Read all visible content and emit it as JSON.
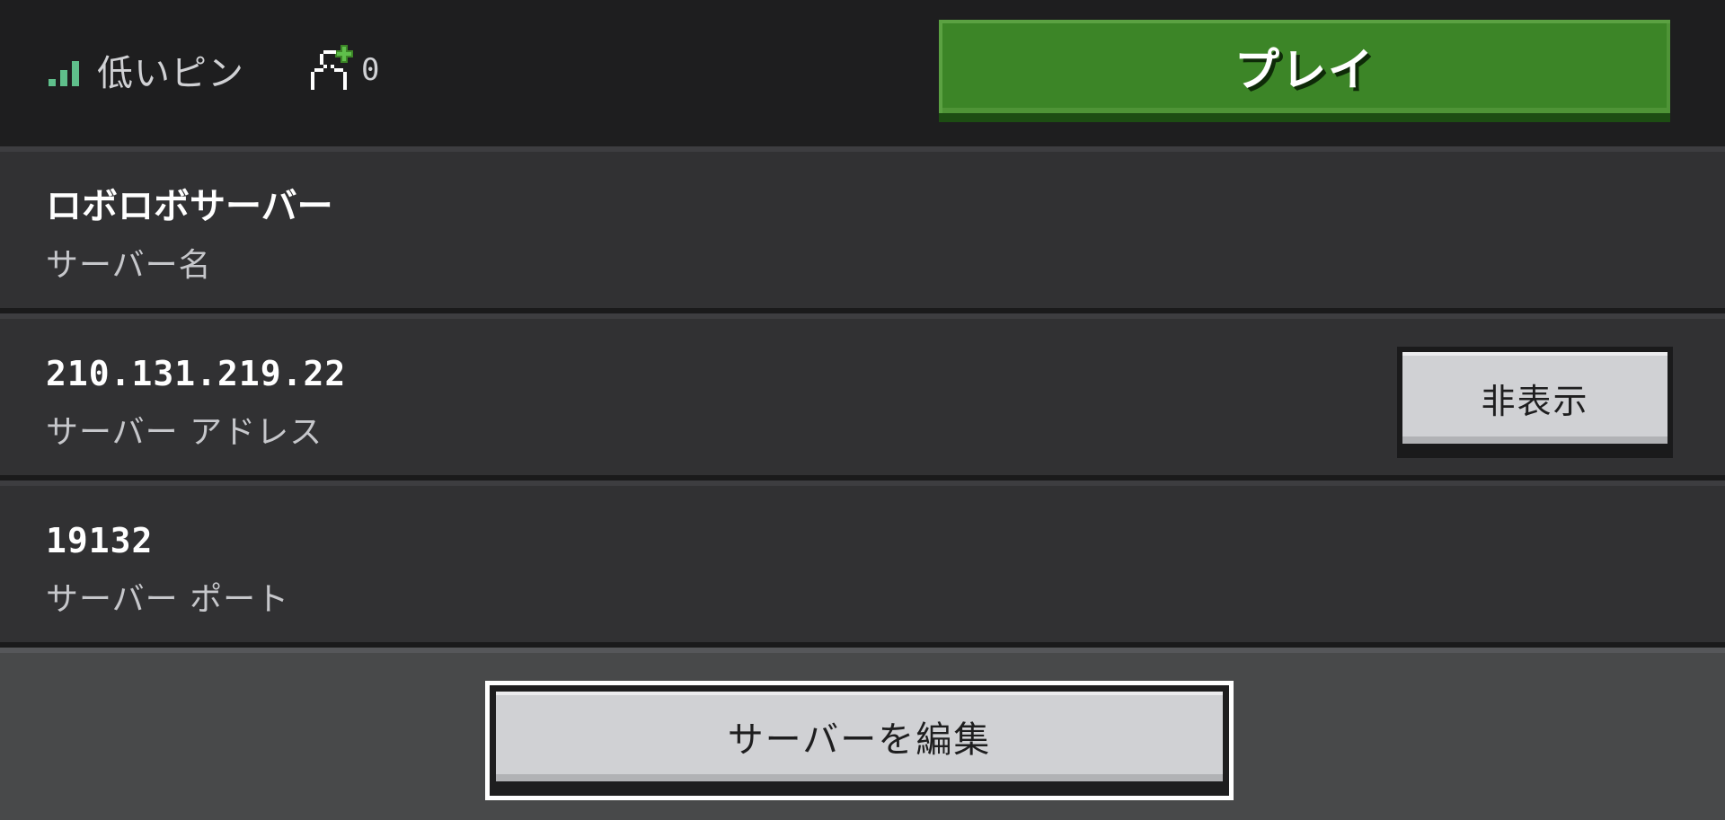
{
  "header": {
    "ping_label": "低いピン",
    "player_count": "0",
    "play_label": "プレイ"
  },
  "server": {
    "name_value": "ロボロボサーバー",
    "name_label": "サーバー名",
    "address_value": "210.131.219.22",
    "address_label": "サーバー アドレス",
    "hide_label": "非表示",
    "port_value": "19132",
    "port_label": "サーバー ポート"
  },
  "footer": {
    "edit_label": "サーバーを編集"
  },
  "colors": {
    "play_green": "#3c8527",
    "signal_green": "#5fbf8b",
    "background": "#1e1e1f",
    "row": "#313133",
    "button_light": "#d0d1d4"
  },
  "icons": {
    "signal": "signal-bars-icon",
    "players": "add-player-icon"
  }
}
